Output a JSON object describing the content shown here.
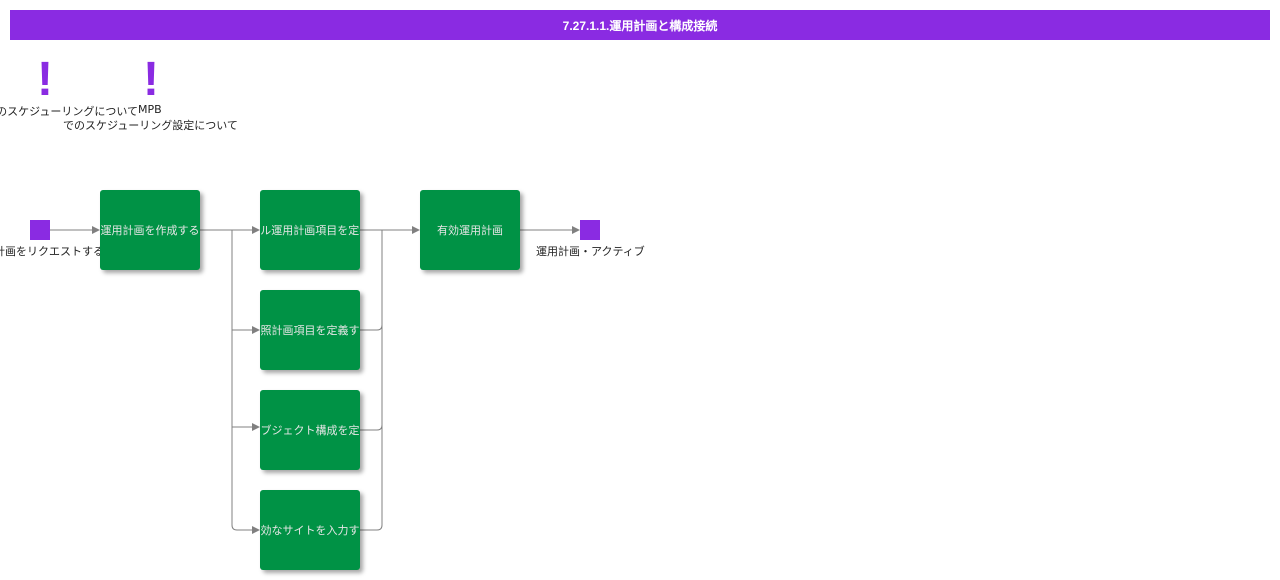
{
  "title": "7.27.1.1.運用計画と構成接続",
  "notes": [
    {
      "text": "のスケジューリングについて"
    },
    {
      "text_line1": "MPB",
      "text_line2": "でのスケジューリング設定について"
    }
  ],
  "start_event": {
    "label": "運用計画をリクエストする"
  },
  "end_event": {
    "label": "運用計画・アクティブ"
  },
  "tasks": [
    {
      "label": "運用計画を作成する"
    },
    {
      "label": "サイクル運用計画項目を定義する"
    },
    {
      "label": "参照計画項目を定義する"
    },
    {
      "label": "運用オブジェクト構成を定義する"
    },
    {
      "label": "有効なサイトを入力する"
    },
    {
      "label": "有効運用計画"
    }
  ],
  "colors": {
    "accent": "#8a2be2",
    "task": "#009245",
    "edge": "#808080"
  }
}
